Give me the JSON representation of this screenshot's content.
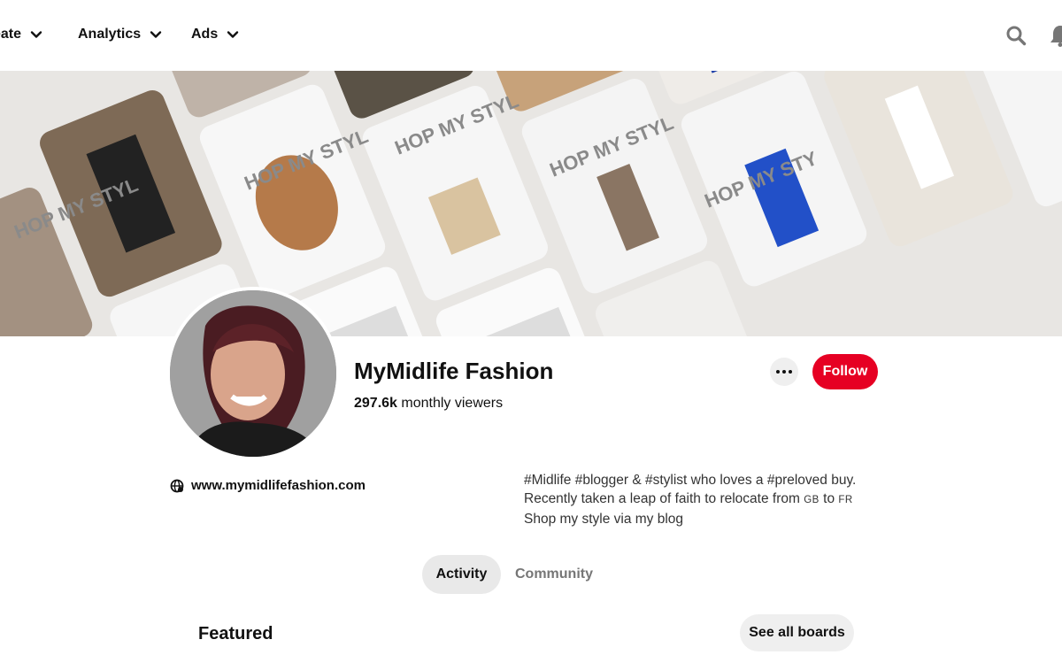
{
  "nav": {
    "create_label": "eate",
    "analytics_label": "Analytics",
    "ads_label": "Ads"
  },
  "cover": {
    "banner_text": "HOP MY STYL",
    "banner_text_alt": "HOP MY STY"
  },
  "profile": {
    "name": "MyMidlife Fashion",
    "viewer_count": "297.6k",
    "viewer_suffix": "monthly viewers",
    "follow_label": "Follow",
    "website": "www.mymidlifefashion.com",
    "bio_line1": "#Midlife #blogger & #stylist who loves a #preloved buy.",
    "bio_line2_a": "Recently taken a leap of faith to relocate from",
    "bio_gb": "GB",
    "bio_to": "to",
    "bio_fr": "FR",
    "bio_line3": "Shop my style via my blog"
  },
  "tabs": {
    "activity": "Activity",
    "community": "Community"
  },
  "featured": {
    "title": "Featured",
    "see_all_label": "See all boards"
  },
  "colors": {
    "accent": "#e60023"
  }
}
